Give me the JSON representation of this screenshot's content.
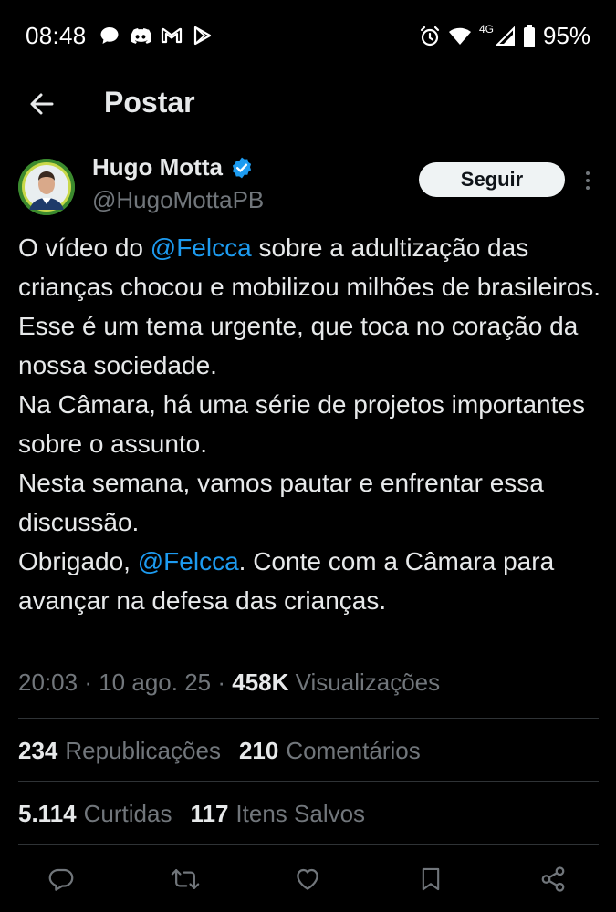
{
  "status_bar": {
    "time": "08:48",
    "network_label": "4G",
    "battery": "95%",
    "left_icons": [
      "chat-bubble-icon",
      "discord-icon",
      "gmail-icon",
      "play-store-icon"
    ],
    "right_icons": [
      "alarm-icon",
      "wifi-icon",
      "signal-icon",
      "battery-icon"
    ]
  },
  "header": {
    "title": "Postar"
  },
  "author": {
    "name": "Hugo Motta",
    "handle": "@HugoMottaPB",
    "verified": true,
    "follow_label": "Seguir"
  },
  "tweet": {
    "segments": [
      {
        "text": "O vídeo do ",
        "type": "text"
      },
      {
        "text": "@Felcca",
        "type": "mention"
      },
      {
        "text": " sobre a adultização das crianças chocou e mobilizou milhões de brasileiros.\nEsse é um tema urgente, que toca no coração da nossa sociedade.\nNa Câmara, há uma série de projetos importantes sobre o assunto.\nNesta semana, vamos pautar e enfrentar essa discussão.\nObrigado, ",
        "type": "text"
      },
      {
        "text": "@Felcca",
        "type": "mention"
      },
      {
        "text": ". Conte com a Câmara para avançar na defesa das crianças.",
        "type": "text"
      }
    ],
    "time": "20:03",
    "date": "10 ago. 25",
    "views_count": "458K",
    "views_label": "Visualizações",
    "separator": "·"
  },
  "stats": {
    "reposts_count": "234",
    "reposts_label": "Republicações",
    "comments_count": "210",
    "comments_label": "Comentários",
    "likes_count": "5.114",
    "likes_label": "Curtidas",
    "saved_count": "117",
    "saved_label": "Itens Salvos"
  },
  "colors": {
    "background": "#000000",
    "text": "#e7e9ea",
    "muted": "#71767b",
    "accent": "#1d9bf0",
    "divider": "#2f3336"
  }
}
